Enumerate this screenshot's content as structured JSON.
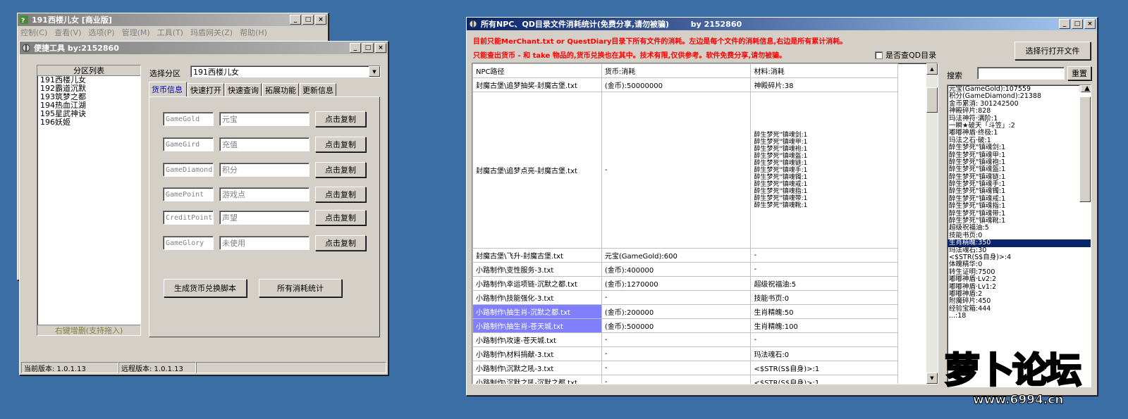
{
  "main_window": {
    "title": "191西楼儿女 [商业版]",
    "menu": [
      "控制(C)",
      "查看(V)",
      "选项(P)",
      "管理(M)",
      "工具(T)",
      "玛盾网关(Z)",
      "帮助(H)"
    ]
  },
  "tool_window": {
    "title": "便捷工具  by:2152860",
    "partition_header": "分区列表",
    "partitions": [
      "191西楼儿女",
      "192霸道沉默",
      "193筑梦之都",
      "194热血江湖",
      "195星武神诀",
      "196妖姬"
    ],
    "partition_footer": "右键增删(支持拖入)",
    "select_label": "选择分区",
    "select_value": "191西楼儿女",
    "tabs": [
      "货币信息",
      "快速打开",
      "快速查询",
      "拓展功能",
      "更新信息"
    ],
    "currency_rows": [
      {
        "code": "GameGold",
        "name": "元宝",
        "button": "点击复制"
      },
      {
        "code": "GameGird",
        "name": "充值",
        "button": "点击复制"
      },
      {
        "code": "GameDiamond",
        "name": "积分",
        "button": "点击复制"
      },
      {
        "code": "GamePoint",
        "name": "游戏点",
        "button": "点击复制"
      },
      {
        "code": "CreditPoint",
        "name": "声望",
        "button": "点击复制"
      },
      {
        "code": "GameGlory",
        "name": "未使用",
        "button": "点击复制"
      }
    ],
    "generate_button": "生成货币兑换脚本",
    "stats_button": "所有消耗统计",
    "status_current": "当前版本: 1.0.1.13",
    "status_remote": "远程版本: 1.0.1.13"
  },
  "stats_window": {
    "title": "所有NPC、QD目录文件消耗统计(免费分享,请勿被骗)        by 2152860",
    "notice1": "目前只能MerChant.txt or QuestDiary目录下所有文件的消耗。左边是每个文件的消耗信息,右边是所有累计消耗。",
    "notice2": "只能查出货币 - 和 take 物品的,货币兑换也在其中。技术有限,仅供参考。软件免费分享,请勿被骗。",
    "checkbox_label": "是否查QD目录",
    "open_button": "选择行打开文件",
    "search_label": "搜索",
    "reset_button": "重置",
    "columns": [
      "NPC路径",
      "货币:消耗",
      "材料:消耗"
    ],
    "rows": [
      {
        "path": "封魔古堡\\追梦抽奖-封魔古堡.txt",
        "currency": "(金币):50000000",
        "material": "神殿碎片:38"
      },
      {
        "path": "封魔古堡\\追梦点亮-封魔古堡.txt",
        "currency": "-",
        "materials": [
          "醉生梦死\"镇魂剑:1",
          "醉生梦死\"镇魂甲:1",
          "醉生梦死\"镇魂袍:1",
          "醉生梦死\"镇魂盔:1",
          "醉生梦死\"镇魂链:1",
          "醉生梦死\"镇魂手:1",
          "醉生梦死\"镇魂镯:1",
          "醉生梦死\"镇魂戒:1",
          "醉生梦死\"镇魂指:1",
          "醉生梦死\"镇魂带:1",
          "醉生梦死\"镇魂靴:1"
        ]
      },
      {
        "path": "封魔古堡\\飞升-封魔古堡.txt",
        "currency": "元宝(GameGold):600",
        "material": "-"
      },
      {
        "path": "小路制作\\变性服务-3.txt",
        "currency": "(金币):400000",
        "material": "-"
      },
      {
        "path": "小路制作\\幸运项链-沉默之都.txt",
        "currency": "(金币):1270000",
        "material": "超级祝福油:5"
      },
      {
        "path": "小路制作\\技能强化-3.txt",
        "currency": "-",
        "material": "技能书页:0"
      },
      {
        "path": "小路制作\\抽生肖-沉默之都.txt",
        "currency": "(金币):200000",
        "material": "生肖精魄:50",
        "highlight": true
      },
      {
        "path": "小路制作\\抽生肖-苍天城.txt",
        "currency": "(金币):500000",
        "material": "生肖精魄:100",
        "highlight": true
      },
      {
        "path": "小路制作\\攻速-苍天城.txt",
        "currency": "-",
        "material": "-"
      },
      {
        "path": "小路制作\\材料捐献-3.txt",
        "currency": "-",
        "material": "玛法魂石:0"
      },
      {
        "path": "小路制作\\沉默之吼-3.txt",
        "currency": "-",
        "material": "<$STR(S$自身)>:1"
      },
      {
        "path": "小路制作\\沉默之吼-沉默之都.txt",
        "currency": "-",
        "material": "<$STR(S$自身)>:1"
      }
    ],
    "totals": [
      "元宝(GameGold):107559",
      "积分(GameDiamond):21388",
      "金币累消: 301242500",
      "神殿碎片:828",
      "玛法神符·满阶:1",
      "一瞬★破天「斗笠」:2",
      "嘟嘟神盾·终极:1",
      "玛法之石·破:1",
      "醉生梦死\"镇魂剑:1",
      "醉生梦死\"镇魂甲:1",
      "醉生梦死\"镇魂袍:1",
      "醉生梦死\"镇魂盔:1",
      "醉生梦死\"镇魂链:1",
      "醉生梦死\"镇魂手:1",
      "醉生梦死\"镇魂镯:1",
      "醉生梦死\"镇魂戒:1",
      "醉生梦死\"镇魂指:1",
      "醉生梦死\"镇魂带:1",
      "醉生梦死\"镇魂靴:1",
      "超级祝福油:5",
      "技能书页:0",
      "生肖精魄:350",
      "玛法魂石:30",
      "<$STR(S$自身)>:4",
      "体魄精华:0",
      "转生证明:7500",
      "嘟嘟神盾·Lv2:2",
      "嘟嘟神盾·Lv1:2",
      "嘟嘟神盾:2",
      "附魔碎片:450",
      "经验宝箱:444",
      "...:18"
    ],
    "selected_total_index": 21
  },
  "watermark": {
    "text": "萝卜论坛",
    "url": "www.6994.cn"
  }
}
